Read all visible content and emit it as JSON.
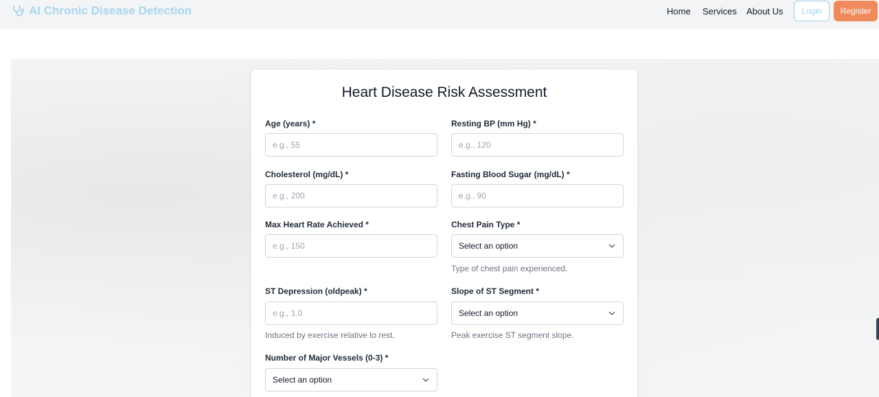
{
  "brand": {
    "name": "AI Chronic Disease Detection",
    "icon": "stethoscope-icon",
    "color": "#9fd2ec"
  },
  "nav": {
    "links": [
      "Home",
      "Services",
      "About Us"
    ],
    "login_label": "Login",
    "register_label": "Register",
    "register_color": "#f08a5d"
  },
  "form": {
    "title": "Heart Disease Risk Assessment",
    "age": {
      "label": "Age (years) *",
      "placeholder": "e.g., 55"
    },
    "resting_bp": {
      "label": "Resting BP (mm Hg) *",
      "placeholder": "e.g., 120"
    },
    "cholesterol": {
      "label": "Cholesterol (mg/dL) *",
      "placeholder": "e.g., 200"
    },
    "fasting_sugar": {
      "label": "Fasting Blood Sugar (mg/dL) *",
      "placeholder": "e.g., 90"
    },
    "max_hr": {
      "label": "Max Heart Rate Achieved *",
      "placeholder": "e.g., 150"
    },
    "chest_pain": {
      "label": "Chest Pain Type *",
      "value": "Select an option",
      "help": "Type of chest pain experienced."
    },
    "st_depression": {
      "label": "ST Depression (oldpeak) *",
      "placeholder": "e.g., 1.0",
      "help": "Induced by exercise relative to rest."
    },
    "slope": {
      "label": "Slope of ST Segment *",
      "value": "Select an option",
      "help": "Peak exercise ST segment slope."
    },
    "vessels": {
      "label": "Number of Major Vessels (0-3) *",
      "value": "Select an option"
    }
  }
}
